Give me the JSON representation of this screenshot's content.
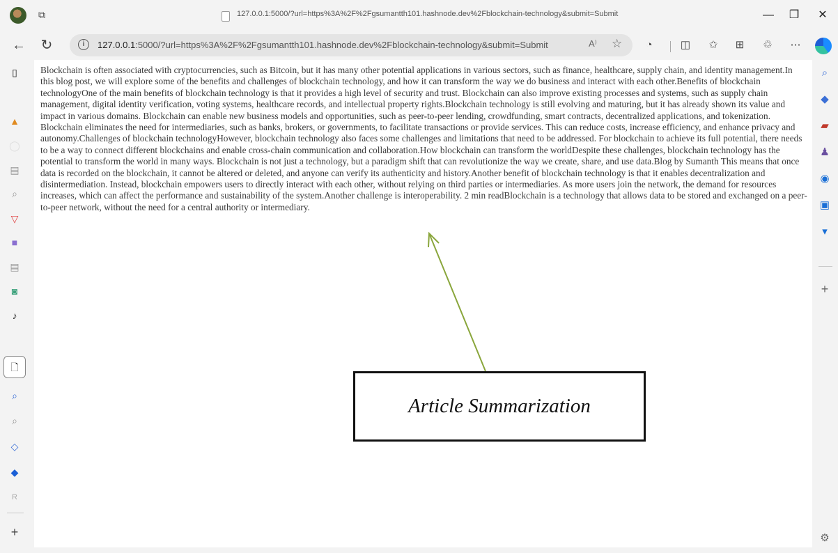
{
  "window": {
    "title": "127.0.0.1:5000/?url=https%3A%2F%2Fgsumantth101.hashnode.dev%2Fblockchain-technology&submit=Submit",
    "controls": {
      "minimize": "—",
      "restore": "❐",
      "close": "✕"
    }
  },
  "address_bar": {
    "url_host": "127.0.0.1",
    "url_rest": ":5000/?url=https%3A%2F%2Fgsumantth101.hashnode.dev%2Fblockchain-technology&submit=Submit",
    "read_aloud": "A⁾"
  },
  "article": {
    "text": "Blockchain is often associated with cryptocurrencies, such as Bitcoin, but it has many other potential applications in various sectors, such as finance, healthcare, supply chain, and identity management.In this blog post, we will explore some of the benefits and challenges of blockchain technology, and how it can transform the way we do business and interact with each other.Benefits of blockchain technologyOne of the main benefits of blockchain technology is that it provides a high level of security and trust. Blockchain can also improve existing processes and systems, such as supply chain management, digital identity verification, voting systems, healthcare records, and intellectual property rights.Blockchain technology is still evolving and maturing, but it has already shown its value and impact in various domains. Blockchain can enable new business models and opportunities, such as peer-to-peer lending, crowdfunding, smart contracts, decentralized applications, and tokenization. Blockchain eliminates the need for intermediaries, such as banks, brokers, or governments, to facilitate transactions or provide services. This can reduce costs, increase efficiency, and enhance privacy and autonomy.Challenges of blockchain technologyHowever, blockchain technology also faces some challenges and limitations that need to be addressed. For blockchain to achieve its full potential, there needs to be a way to connect different blockchains and enable cross-chain communication and collaboration.How blockchain can transform the worldDespite these challenges, blockchain technology has the potential to transform the world in many ways. Blockchain is not just a technology, but a paradigm shift that can revolutionize the way we create, share, and use data.Blog by Sumanth This means that once data is recorded on the blockchain, it cannot be altered or deleted, and anyone can verify its authenticity and history.Another benefit of blockchain technology is that it enables decentralization and disintermediation. Instead, blockchain empowers users to directly interact with each other, without relying on third parties or intermediaries. As more users join the network, the demand for resources increases, which can affect the performance and sustainability of the system.Another challenge is interoperability. 2 min readBlockchain is a technology that allows data to be stored and exchanged on a peer-to-peer network, without the need for a central authority or intermediary."
  },
  "annotation": {
    "label": "Article Summarization",
    "arrow_color": "#8aa63c"
  }
}
